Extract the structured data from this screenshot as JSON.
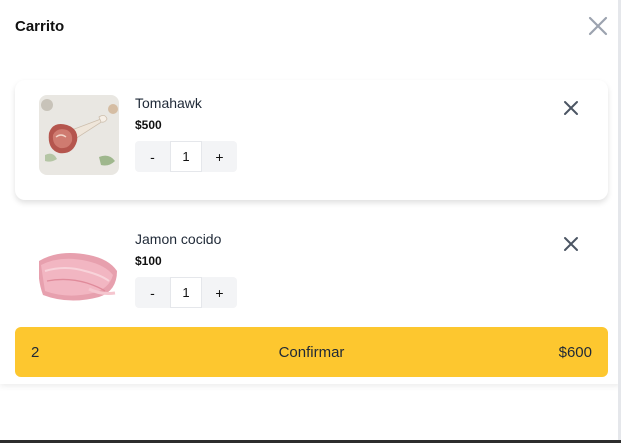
{
  "cart": {
    "title": "Carrito",
    "close_icon": "close-icon",
    "items": [
      {
        "name": "Tomahawk",
        "price": "$500",
        "quantity": "1",
        "decrement_label": "-",
        "increment_label": "+",
        "image_icon": "tomahawk-steak-image",
        "remove_icon": "remove-icon"
      },
      {
        "name": "Jamon cocido",
        "price": "$100",
        "quantity": "1",
        "decrement_label": "-",
        "increment_label": "+",
        "image_icon": "ham-slices-image",
        "remove_icon": "remove-icon"
      }
    ],
    "summary": {
      "count": "2",
      "confirm_label": "Confirmar",
      "total": "$600"
    },
    "colors": {
      "accent": "#fdc72f",
      "stepper_bg": "#f3f4f6",
      "close_icon": "#9ca3af",
      "remove_icon": "#4b5563"
    }
  }
}
